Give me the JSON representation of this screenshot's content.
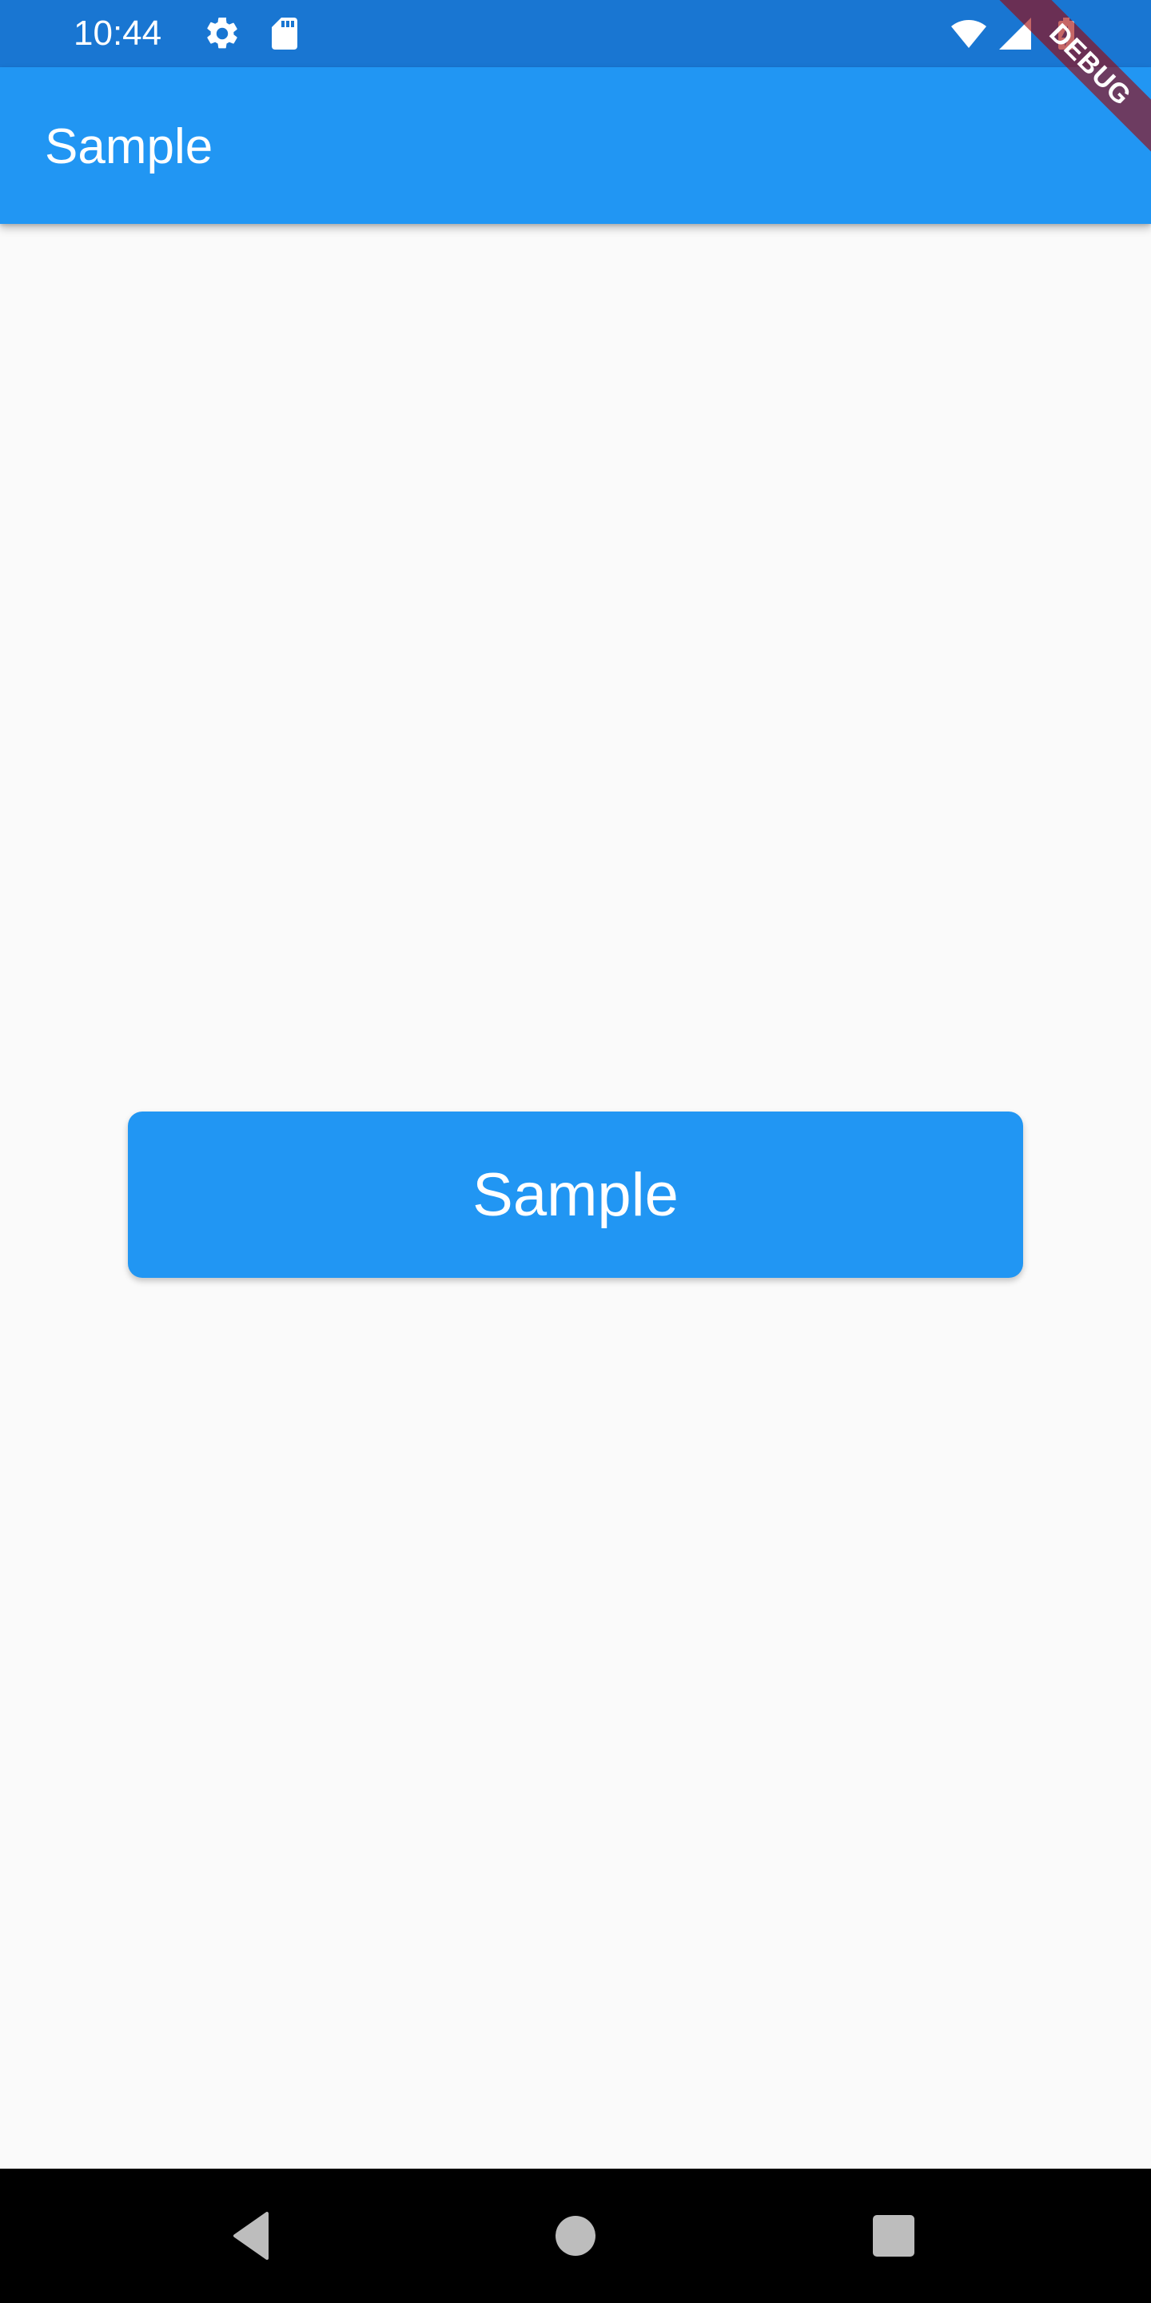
{
  "status_bar": {
    "time": "10:44",
    "background": "#1976d2",
    "icons": [
      "gear-icon",
      "sd-card-icon",
      "wifi-icon",
      "signal-icon",
      "battery-icon"
    ]
  },
  "app_bar": {
    "title": "Sample",
    "background": "#2196f3",
    "debug_banner": "DEBUG"
  },
  "main": {
    "button_label": "Sample",
    "button_color": "#2196f3"
  },
  "nav_bar": {
    "background": "#000000",
    "buttons": [
      "back-icon",
      "home-icon",
      "recents-icon"
    ]
  }
}
